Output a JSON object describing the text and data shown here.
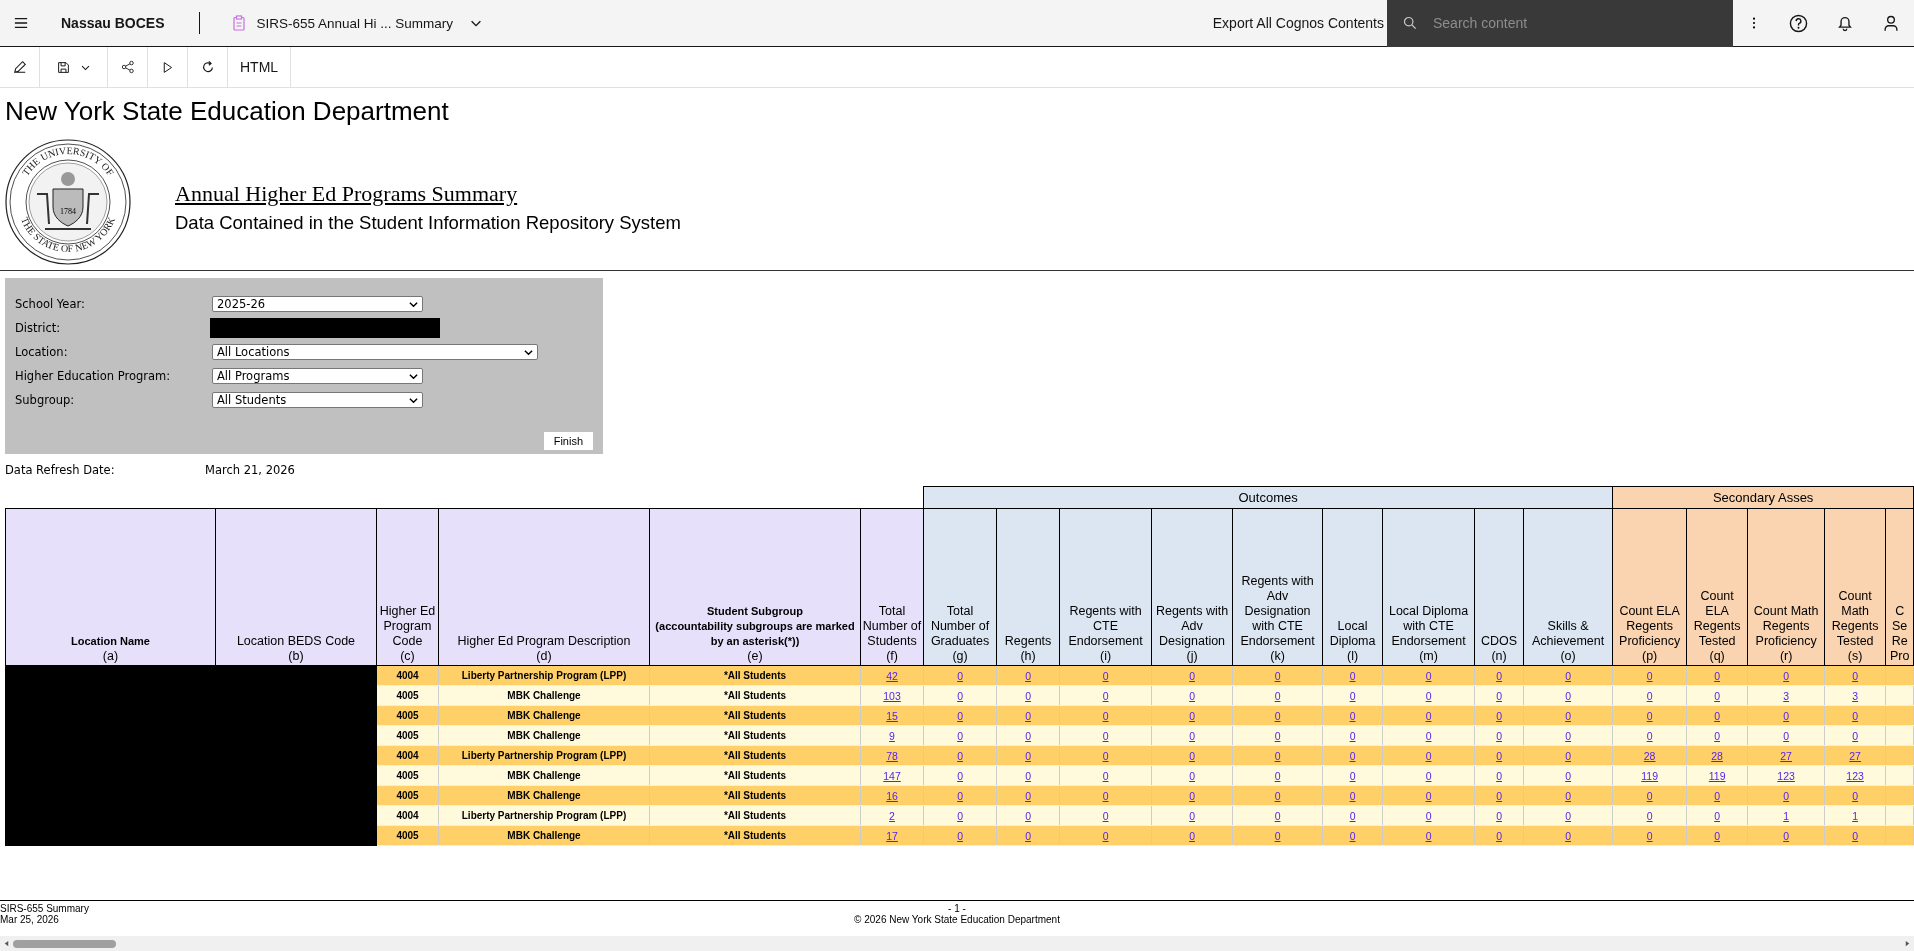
{
  "top_bar": {
    "org": "Nassau BOCES",
    "report_title": "SIRS-655 Annual Hi ... Summary",
    "export_link": "Export All Cognos Contents",
    "search": {
      "placeholder": "Search content"
    }
  },
  "toolbar": {
    "format": "HTML"
  },
  "report": {
    "agency": "New York State Education Department",
    "seal": {
      "top_text": "THE UNIVERSITY OF",
      "bottom_text": "THE STATE OF NEW YORK",
      "year": "1784"
    },
    "title": "Annual Higher Ed Programs Summary",
    "subtitle": "Data Contained in the Student Information Repository System"
  },
  "prompts": {
    "fields": [
      {
        "kind": "select",
        "label": "School Year:",
        "value": "2025-26"
      },
      {
        "kind": "redacted",
        "label": "District:"
      },
      {
        "kind": "select",
        "label": "Location:",
        "value": "All Locations"
      },
      {
        "kind": "select",
        "label": "Higher Education Program:",
        "value": "All Programs"
      },
      {
        "kind": "select",
        "label": "Subgroup:",
        "value": "All Students"
      }
    ],
    "finish": "Finish"
  },
  "refresh": {
    "label": "Data Refresh Date:",
    "value": "March 21, 2026"
  },
  "table": {
    "redacted": true,
    "column_groups": [
      {
        "color": "#e6e0fa",
        "columns": [
          {
            "kind": "bold",
            "label": "Location Name",
            "letter": "(a)"
          },
          {
            "kind": "plain",
            "label": "Location BEDS Code",
            "letter": "(b)"
          },
          {
            "kind": "plain",
            "label": "Higher Ed Program Code",
            "letter": "(c)"
          },
          {
            "kind": "plain",
            "label": "Higher Ed Program Description",
            "letter": "(d)"
          },
          {
            "kind": "bold",
            "label": "Student Subgroup",
            "note": "(accountability subgroups are marked by an asterisk(*))",
            "letter": "(e)"
          },
          {
            "kind": "plain",
            "label": "Total Number of Students",
            "letter": "(f)"
          }
        ]
      },
      {
        "label": "Outcomes",
        "color": "#dce6f2",
        "columns": [
          {
            "kind": "plain",
            "label": "Total Number of Graduates",
            "letter": "(g)"
          },
          {
            "kind": "plain",
            "label": "Regents",
            "letter": "(h)"
          },
          {
            "kind": "plain",
            "label": "Regents with CTE Endorsement",
            "letter": "(i)"
          },
          {
            "kind": "plain",
            "label": "Regents with Adv Designation",
            "letter": "(j)"
          },
          {
            "kind": "plain",
            "label": "Regents with Adv Designation with CTE Endorsement",
            "letter": "(k)"
          },
          {
            "kind": "plain",
            "label": "Local Diploma",
            "letter": "(l)"
          },
          {
            "kind": "plain",
            "label": "Local Diploma with CTE Endorsement",
            "letter": "(m)"
          },
          {
            "kind": "plain",
            "label": "CDOS",
            "letter": "(n)"
          },
          {
            "kind": "plain",
            "label": "Skills & Achievement",
            "letter": "(o)"
          }
        ]
      },
      {
        "label": "Secondary Asses",
        "color": "#fad3b0",
        "columns": [
          {
            "kind": "plain",
            "label": "Count ELA Regents Proficiency",
            "letter": "(p)"
          },
          {
            "kind": "plain",
            "label": "Count ELA Regents Tested",
            "letter": "(q)"
          },
          {
            "kind": "plain",
            "label": "Count Math Regents Proficiency",
            "letter": "(r)"
          },
          {
            "kind": "plain",
            "label": "Count Math Regents Tested",
            "letter": "(s)"
          },
          {
            "kind": "plain",
            "label": "C Se Re Pro"
          }
        ]
      }
    ],
    "rows": [
      {
        "code": "4004",
        "description": "Liberty Partnership Program (LPP)",
        "subgroup": "*All Students",
        "values": [
          "42",
          "0",
          "0",
          "0",
          "0",
          "0",
          "0",
          "0",
          "0",
          "0",
          "0",
          "0",
          "0",
          "0"
        ]
      },
      {
        "code": "4005",
        "description": "MBK Challenge",
        "subgroup": "*All Students",
        "values": [
          "103",
          "0",
          "0",
          "0",
          "0",
          "0",
          "0",
          "0",
          "0",
          "0",
          "0",
          "0",
          "3",
          "3"
        ]
      },
      {
        "code": "4005",
        "description": "MBK Challenge",
        "subgroup": "*All Students",
        "values": [
          "15",
          "0",
          "0",
          "0",
          "0",
          "0",
          "0",
          "0",
          "0",
          "0",
          "0",
          "0",
          "0",
          "0"
        ]
      },
      {
        "code": "4005",
        "description": "MBK Challenge",
        "subgroup": "*All Students",
        "values": [
          "9",
          "0",
          "0",
          "0",
          "0",
          "0",
          "0",
          "0",
          "0",
          "0",
          "0",
          "0",
          "0",
          "0"
        ]
      },
      {
        "code": "4004",
        "description": "Liberty Partnership Program (LPP)",
        "subgroup": "*All Students",
        "values": [
          "78",
          "0",
          "0",
          "0",
          "0",
          "0",
          "0",
          "0",
          "0",
          "0",
          "28",
          "28",
          "27",
          "27"
        ]
      },
      {
        "code": "4005",
        "description": "MBK Challenge",
        "subgroup": "*All Students",
        "values": [
          "147",
          "0",
          "0",
          "0",
          "0",
          "0",
          "0",
          "0",
          "0",
          "0",
          "119",
          "119",
          "123",
          "123"
        ]
      },
      {
        "code": "4005",
        "description": "MBK Challenge",
        "subgroup": "*All Students",
        "values": [
          "16",
          "0",
          "0",
          "0",
          "0",
          "0",
          "0",
          "0",
          "0",
          "0",
          "0",
          "0",
          "0",
          "0"
        ]
      },
      {
        "code": "4004",
        "description": "Liberty Partnership Program (LPP)",
        "subgroup": "*All Students",
        "values": [
          "2",
          "0",
          "0",
          "0",
          "0",
          "0",
          "0",
          "0",
          "0",
          "0",
          "0",
          "0",
          "1",
          "1"
        ]
      },
      {
        "code": "4005",
        "description": "MBK Challenge",
        "subgroup": "*All Students",
        "values": [
          "17",
          "0",
          "0",
          "0",
          "0",
          "0",
          "0",
          "0",
          "0",
          "0",
          "0",
          "0",
          "0",
          "0"
        ]
      }
    ]
  },
  "footer": {
    "report_name": "SIRS-655 Summary",
    "run_date": "Mar 25, 2026",
    "page": "- 1 -",
    "copyright": "© 2026 New York State Education Department"
  }
}
